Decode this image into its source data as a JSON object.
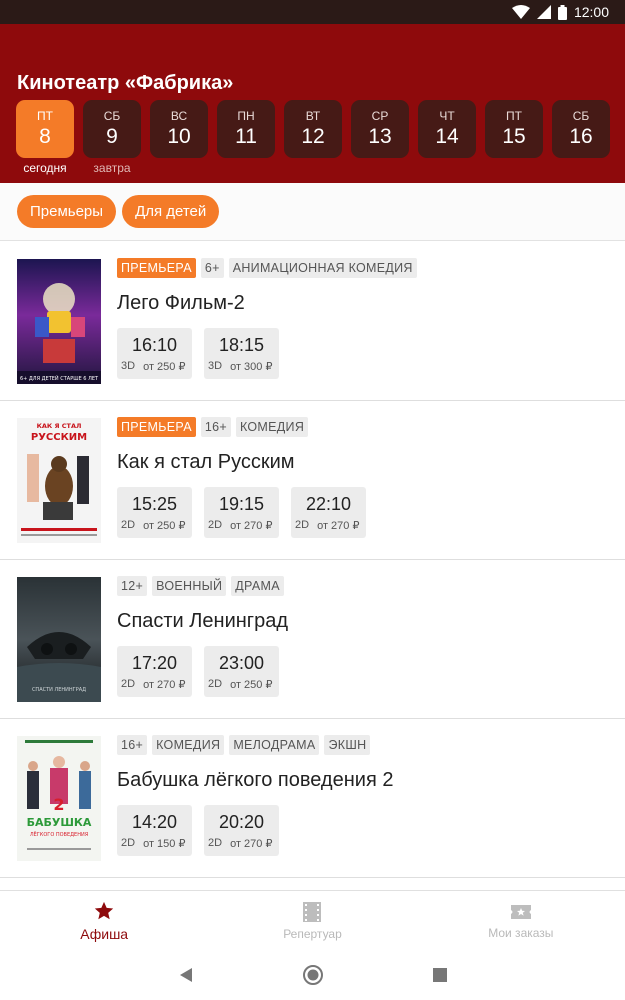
{
  "status": {
    "time": "12:00"
  },
  "header": {
    "title": "Кинотеатр «Фабрика»"
  },
  "days": [
    {
      "weekday": "ПТ",
      "num": "8",
      "sub": "сегодня",
      "active": true
    },
    {
      "weekday": "СБ",
      "num": "9",
      "sub": "завтра"
    },
    {
      "weekday": "ВС",
      "num": "10",
      "sub": ""
    },
    {
      "weekday": "ПН",
      "num": "11",
      "sub": ""
    },
    {
      "weekday": "ВТ",
      "num": "12",
      "sub": ""
    },
    {
      "weekday": "СР",
      "num": "13",
      "sub": ""
    },
    {
      "weekday": "ЧТ",
      "num": "14",
      "sub": ""
    },
    {
      "weekday": "ПТ",
      "num": "15",
      "sub": ""
    },
    {
      "weekday": "СБ",
      "num": "16",
      "sub": ""
    }
  ],
  "filters": [
    "Премьеры",
    "Для детей"
  ],
  "movies": [
    {
      "tags": [
        {
          "text": "ПРЕМЬЕРА",
          "premiere": true
        },
        {
          "text": "6+"
        },
        {
          "text": "АНИМАЦИОННАЯ КОМЕДИЯ"
        }
      ],
      "title": "Лего Фильм-2",
      "sessions": [
        {
          "time": "16:10",
          "format": "3D",
          "price": "от 250 ₽"
        },
        {
          "time": "18:15",
          "format": "3D",
          "price": "от 300 ₽"
        }
      ]
    },
    {
      "tags": [
        {
          "text": "ПРЕМЬЕРА",
          "premiere": true
        },
        {
          "text": "16+"
        },
        {
          "text": "КОМЕДИЯ"
        }
      ],
      "title": "Как я стал Русским",
      "sessions": [
        {
          "time": "15:25",
          "format": "2D",
          "price": "от 250 ₽"
        },
        {
          "time": "19:15",
          "format": "2D",
          "price": "от 270 ₽"
        },
        {
          "time": "22:10",
          "format": "2D",
          "price": "от 270 ₽"
        }
      ]
    },
    {
      "tags": [
        {
          "text": "12+"
        },
        {
          "text": "ВОЕННЫЙ"
        },
        {
          "text": "ДРАМА"
        }
      ],
      "title": "Спасти Ленинград",
      "sessions": [
        {
          "time": "17:20",
          "format": "2D",
          "price": "от 270 ₽"
        },
        {
          "time": "23:00",
          "format": "2D",
          "price": "от 250 ₽"
        }
      ]
    },
    {
      "tags": [
        {
          "text": "16+"
        },
        {
          "text": "КОМЕДИЯ"
        },
        {
          "text": "МЕЛОДРАМА"
        },
        {
          "text": "ЭКШН"
        }
      ],
      "title": "Бабушка лёгкого поведения 2",
      "sessions": [
        {
          "time": "14:20",
          "format": "2D",
          "price": "от 150 ₽"
        },
        {
          "time": "20:20",
          "format": "2D",
          "price": "от 270 ₽"
        }
      ]
    }
  ],
  "poster_text": {
    "lego": "6+ ДЛЯ ДЕТЕЙ СТАРШЕ 6 ЛЕТ",
    "russian": [
      "КАК Я СТАЛ",
      "РУССКИМ"
    ],
    "leningrad": "СПАСТИ ЛЕНИНГРАД",
    "babushka": [
      "2",
      "БАБУШКА",
      "ЛЁГКОГО ПОВЕДЕНИЯ"
    ]
  },
  "nav": [
    {
      "label": "Афиша",
      "icon": "star-icon",
      "active": true
    },
    {
      "label": "Репертуар",
      "icon": "film-icon"
    },
    {
      "label": "Мои заказы",
      "icon": "ticket-icon"
    }
  ],
  "colors": {
    "header": "#8e0a0c",
    "accent": "#f47b28",
    "day_tile": "#461a16"
  }
}
